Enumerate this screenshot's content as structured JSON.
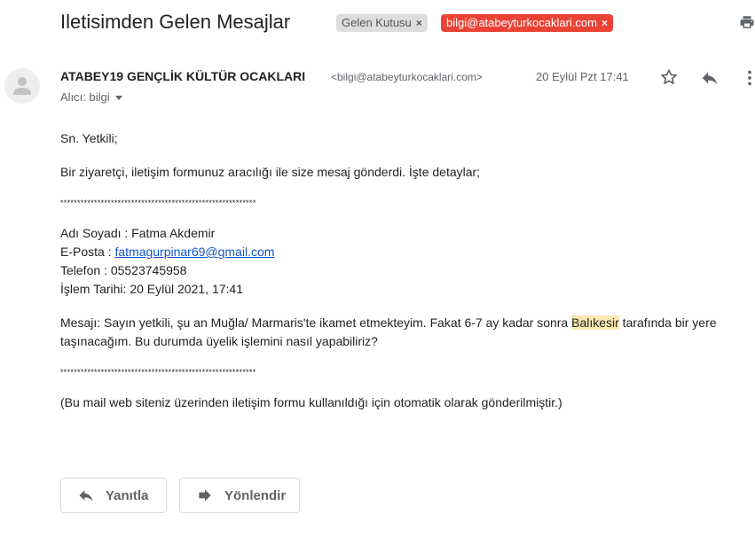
{
  "header": {
    "subject": "Iletisimden Gelen Mesajlar",
    "labels": [
      {
        "text": "Gelen Kutusu",
        "remove": "×"
      },
      {
        "text": "bilgi@atabeyturkocaklari.com",
        "remove": "×"
      }
    ]
  },
  "sender": {
    "name": "ATABEY19 GENÇLİK KÜLTÜR OCAKLARI",
    "email": "<bilgi@atabeyturkocaklari.com>",
    "date": "20 Eylül Pzt 17:41",
    "recipient": "Alıcı: bilgi"
  },
  "message": {
    "greeting": "Sn. Yetkili;",
    "intro": "Bir ziyaretçi, iletişim formunuz aracılığı ile size mesaj gönderdi. İşte detaylar;",
    "separator": "**********************************************************",
    "name_line": "Adı Soyadı : Fatma Akdemir",
    "email_label": "E-Posta : ",
    "email_value": "fatmagurpinar69@gmail.com",
    "phone_line": "Telefon : 05523745958",
    "date_line": "İşlem Tarihi: 20 Eylül 2021, 17:41",
    "msg_part1": "Mesajı: Sayın yetkili, şu an Muğla/ Marmaris'te ikamet etmekteyim. Fakat 6-7 ay kadar sonra ",
    "msg_highlight": "Balıkesir",
    "msg_part2": " tarafında bir yere taşınacağım. Bu durumda üyelik işlemini nasıl yapabiliriz?",
    "footer": "(Bu mail web siteniz üzerinden iletişim formu kullanıldığı için otomatik olarak gönderilmiştir.)"
  },
  "actions": {
    "reply_label": "Yanıtla",
    "forward_label": "Yönlendir"
  },
  "colors": {
    "label_red": "#ea4335",
    "label_gray": "#dddddd",
    "link_blue": "#1155cc",
    "highlight": "#fce8b2"
  },
  "icons": [
    "print-icon",
    "avatar-person-icon",
    "star-icon",
    "reply-icon",
    "more-vert-icon",
    "reply-arrow-icon",
    "forward-arrow-icon"
  ]
}
